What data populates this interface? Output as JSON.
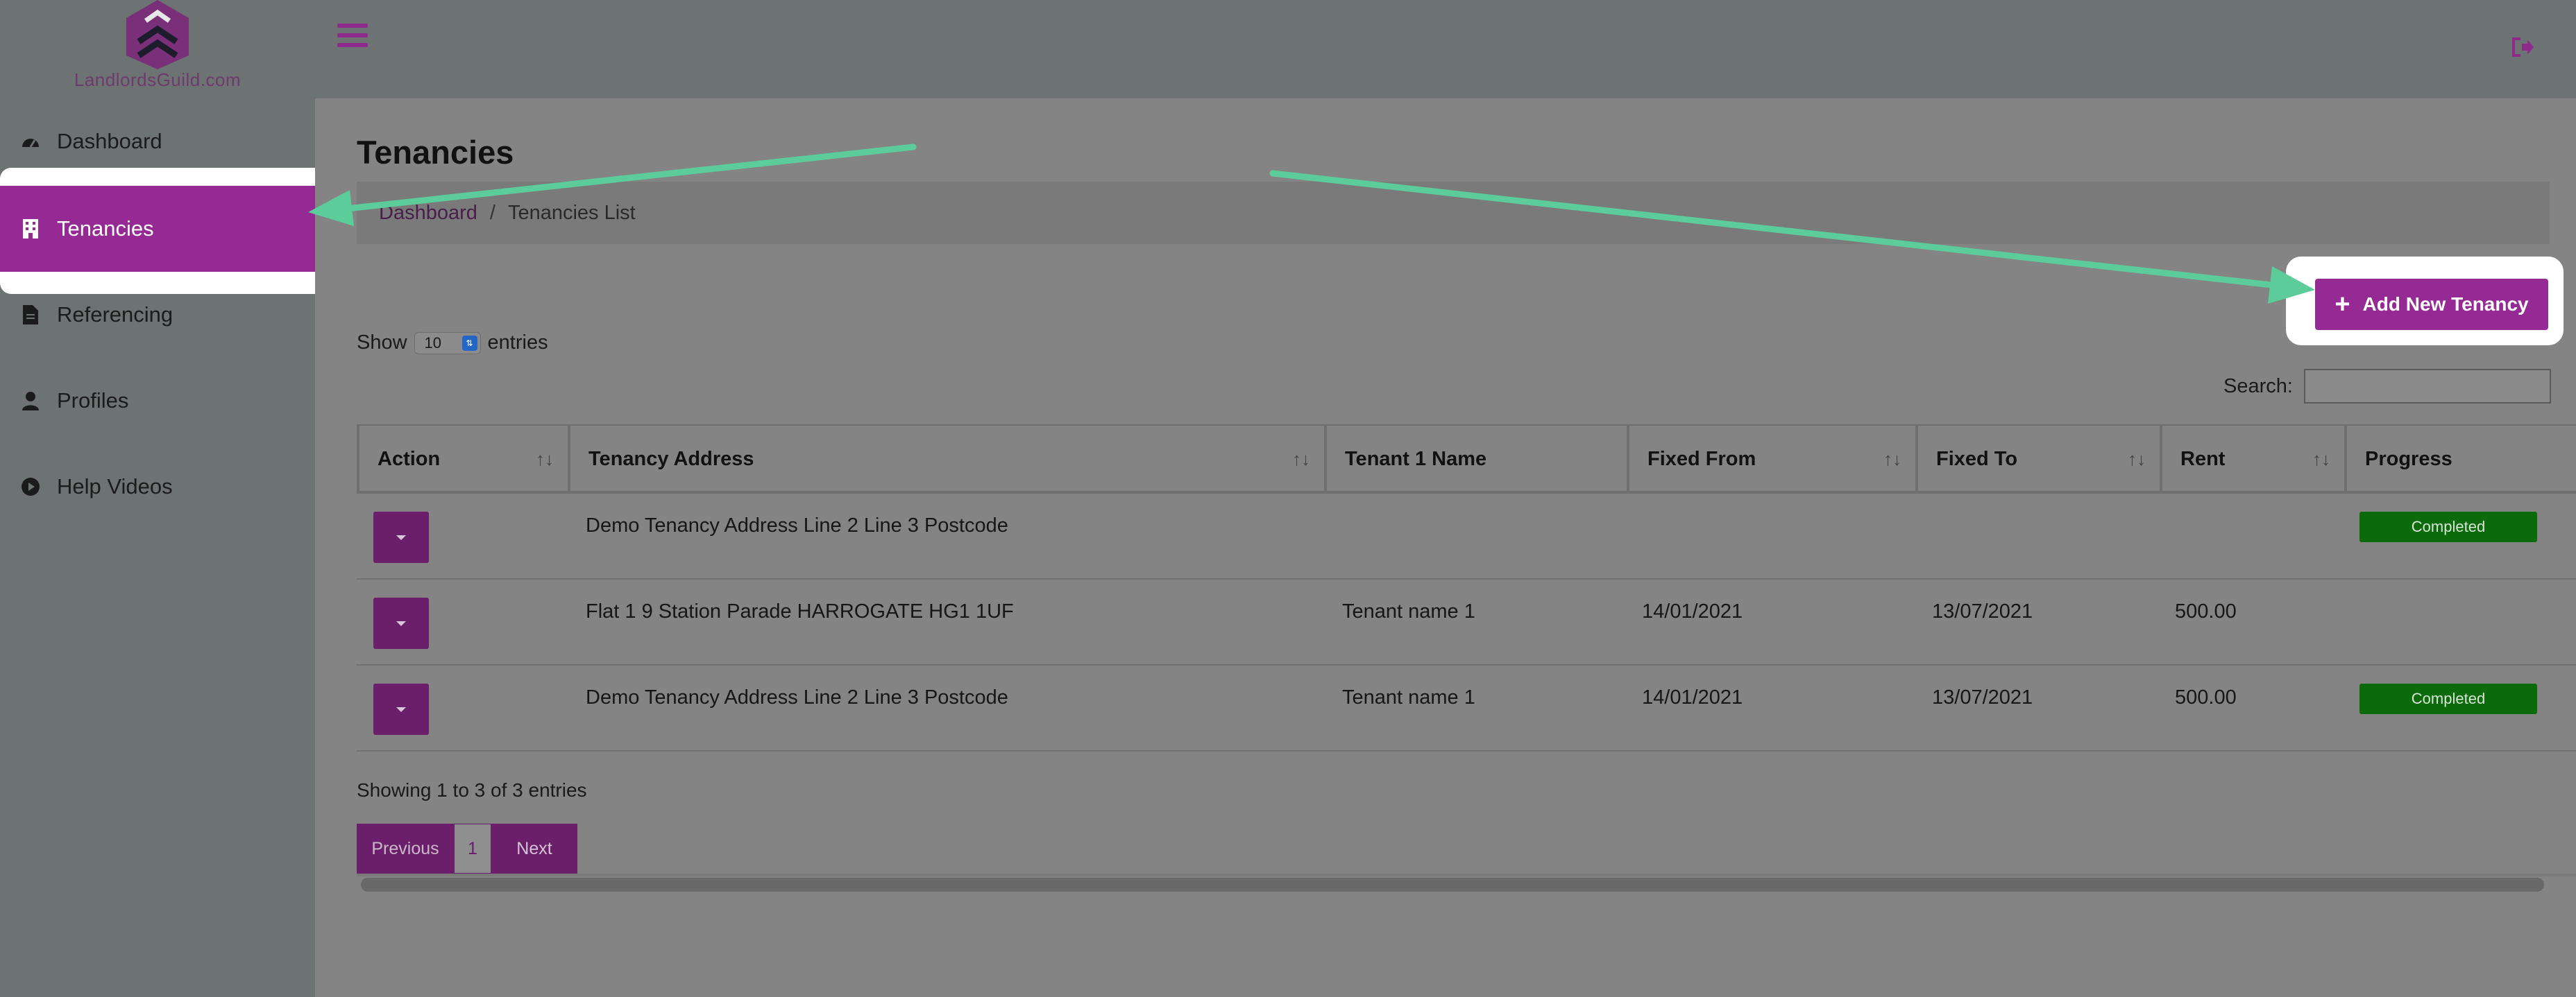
{
  "brand": {
    "logo_text": "LandlordsGuild.com"
  },
  "sidebar": {
    "items": [
      {
        "label": "Dashboard",
        "icon": "dashboard-icon"
      },
      {
        "label": "Tenancies",
        "icon": "building-icon"
      },
      {
        "label": "Referencing",
        "icon": "document-icon"
      },
      {
        "label": "Profiles",
        "icon": "user-icon"
      },
      {
        "label": "Help Videos",
        "icon": "play-circle-icon"
      }
    ],
    "active_index": 1
  },
  "topbar": {
    "menu_icon": "hamburger-icon",
    "logout_icon": "logout-icon"
  },
  "page": {
    "title": "Tenancies",
    "breadcrumb": {
      "link": "Dashboard",
      "separator": "/",
      "current": "Tenancies List"
    },
    "add_button": {
      "label": "Add New Tenancy",
      "icon": "+"
    }
  },
  "table_controls": {
    "show_label": "Show",
    "entries_value": "10",
    "entries_label": "entries",
    "search_label": "Search:",
    "search_value": ""
  },
  "table": {
    "headers": [
      "Action",
      "Tenancy Address",
      "Tenant 1 Name",
      "Fixed From",
      "Fixed To",
      "Rent",
      "Progress"
    ],
    "rows": [
      {
        "address": "Demo Tenancy Address Line 2 Line 3 Postcode",
        "tenant": "",
        "from": "",
        "to": "",
        "rent": "",
        "progress": "Completed"
      },
      {
        "address": "Flat 1 9 Station Parade HARROGATE HG1 1UF",
        "tenant": "Tenant name 1",
        "from": "14/01/2021",
        "to": "13/07/2021",
        "rent": "500.00",
        "progress": ""
      },
      {
        "address": "Demo Tenancy Address Line 2 Line 3 Postcode",
        "tenant": "Tenant name 1",
        "from": "14/01/2021",
        "to": "13/07/2021",
        "rent": "500.00",
        "progress": "Completed"
      }
    ]
  },
  "footer": {
    "showing": "Showing 1 to 3 of 3 entries",
    "previous": "Previous",
    "page": "1",
    "next": "Next"
  },
  "colors": {
    "accent": "#962a95",
    "dark_accent": "#6b1e6a",
    "completed": "#0b6b0b",
    "annotation_arrow": "#5ccc9a"
  }
}
